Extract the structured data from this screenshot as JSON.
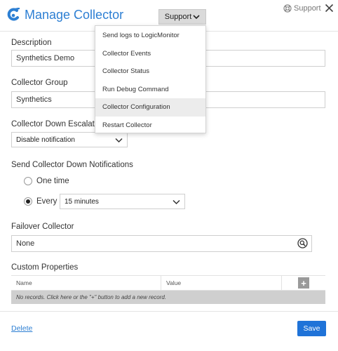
{
  "header": {
    "title": "Manage Collector",
    "support_button_label": "Support",
    "top_support_label": "Support",
    "accent_color": "#2d7fd3"
  },
  "support_menu": {
    "items": [
      {
        "label": "Send logs to LogicMonitor",
        "active": false
      },
      {
        "label": "Collector Events",
        "active": false
      },
      {
        "label": "Collector Status",
        "active": false
      },
      {
        "label": "Run Debug Command",
        "active": false
      },
      {
        "label": "Collector Configuration",
        "active": true
      },
      {
        "label": "Restart Collector",
        "active": false
      }
    ]
  },
  "form": {
    "description": {
      "label": "Description",
      "value": "Synthetics Demo"
    },
    "collector_group": {
      "label": "Collector Group",
      "value": "Synthetics"
    },
    "down_escalation": {
      "label": "Collector Down Escalati",
      "value": "Disable notification"
    },
    "down_notifications": {
      "label": "Send Collector Down Notifications",
      "option_one_time": "One time",
      "option_every": "Every",
      "selected": "Every",
      "interval": "15 minutes"
    },
    "failover_collector": {
      "label": "Failover Collector",
      "value": "None"
    },
    "custom_properties": {
      "label": "Custom Properties",
      "columns": [
        "Name",
        "Value"
      ],
      "add_label": "+",
      "empty_message": "No records. Click here or the \"+\" button to add a new record."
    }
  },
  "footer": {
    "delete_label": "Delete",
    "save_label": "Save",
    "save_color": "#1f73d8"
  }
}
